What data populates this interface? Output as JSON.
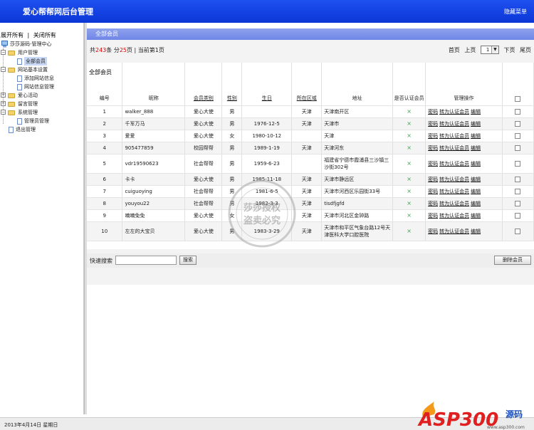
{
  "header": {
    "title": "爱心帮帮网后台管理",
    "hide_menu": "隐藏菜单"
  },
  "sidebar": {
    "expand_all": "展开所有",
    "separator": "|",
    "collapse_all": "关闭所有",
    "root_label": "莎莎源码-管理中心",
    "items": [
      {
        "label": "用户管理",
        "type": "folder",
        "level": 1
      },
      {
        "label": "全部会员",
        "type": "page",
        "level": 2,
        "selected": true
      },
      {
        "label": "网站基本设置",
        "type": "folder",
        "level": 1
      },
      {
        "label": "添加网站信息",
        "type": "page",
        "level": 2
      },
      {
        "label": "网站信息管理",
        "type": "page",
        "level": 2
      },
      {
        "label": "爱心活动",
        "type": "folder",
        "level": 1
      },
      {
        "label": "留言管理",
        "type": "folder",
        "level": 1
      },
      {
        "label": "系统管理",
        "type": "folder",
        "level": 1
      },
      {
        "label": "管理员管理",
        "type": "page",
        "level": 2
      },
      {
        "label": "退出管理",
        "type": "page",
        "level": 1
      }
    ]
  },
  "main": {
    "section_title": "全部会员",
    "pager": {
      "prefix": "共",
      "total": "243",
      "mid": "条 分",
      "pages": "25",
      "suffix": "页 | 当前第1页",
      "first": "首页",
      "prev": "上页",
      "page_select": "1",
      "next": "下页",
      "last": "尾页"
    },
    "table_caption": "全部会员",
    "columns": [
      "编号",
      "昵称",
      "会员类别",
      "性别",
      "生日",
      "所在区域",
      "地址",
      "是否认证会员",
      "管理操作"
    ],
    "rows": [
      {
        "id": "1",
        "nick": "walker_888",
        "cat": "爱心大使",
        "sex": "男",
        "birth": "",
        "area": "天津",
        "addr": "天津南开区",
        "ver": "×"
      },
      {
        "id": "2",
        "nick": "千军万马",
        "cat": "爱心大使",
        "sex": "男",
        "birth": "1976-12-5",
        "area": "天津",
        "addr": "天津市",
        "ver": "×"
      },
      {
        "id": "3",
        "nick": "爱爱",
        "cat": "爱心大使",
        "sex": "女",
        "birth": "1980-10-12",
        "area": "",
        "addr": "天津",
        "ver": "×"
      },
      {
        "id": "4",
        "nick": "905477859",
        "cat": "校园帮帮",
        "sex": "男",
        "birth": "1989-1-19",
        "area": "天津",
        "addr": "天津河东",
        "ver": "×"
      },
      {
        "id": "5",
        "nick": "vdr19590623",
        "cat": "社会帮帮",
        "sex": "男",
        "birth": "1959-6-23",
        "area": "",
        "addr": "福建省宁德市霞浦县三沙镇三沙街302号",
        "ver": "×"
      },
      {
        "id": "6",
        "nick": "卡卡",
        "cat": "爱心大使",
        "sex": "男",
        "birth": "1985-11-18",
        "area": "天津",
        "addr": "天津市静远区",
        "ver": "×"
      },
      {
        "id": "7",
        "nick": "cuiguoying",
        "cat": "社会帮帮",
        "sex": "男",
        "birth": "1981-6-5",
        "area": "天津",
        "addr": "天津市河西区乐园街33号",
        "ver": "×"
      },
      {
        "id": "8",
        "nick": "youyou22",
        "cat": "社会帮帮",
        "sex": "男",
        "birth": "1982-3-3",
        "area": "天津",
        "addr": "tisdfjgfd",
        "ver": "×"
      },
      {
        "id": "9",
        "nick": "喃喃免免",
        "cat": "爱心大使",
        "sex": "女",
        "birth": "",
        "area": "天津",
        "addr": "天津市河北区金钟路",
        "ver": "×"
      },
      {
        "id": "10",
        "nick": "左左的大宝贝",
        "cat": "爱心大使",
        "sex": "男",
        "birth": "1983-3-29",
        "area": "天津",
        "addr": "天津市和平区气象台路12号天津医科大学口腔医院",
        "ver": "×"
      }
    ],
    "ops": {
      "password": "密码",
      "to_verified": "转为认证会员",
      "edit": "编辑"
    },
    "quick_search": "快速搜索",
    "search_value": "",
    "search_button": "搜索",
    "delete_button": "删除会员"
  },
  "status": {
    "date": "2013年4月14日 星期日"
  },
  "watermark": {
    "line1": "莎莎授权",
    "line2": "盗卖必究",
    "ring": "莎莎·盗卖必究·印章"
  },
  "logo": {
    "text": "ASP300",
    "sub": "源码",
    "domain": "www.asp300.com"
  }
}
